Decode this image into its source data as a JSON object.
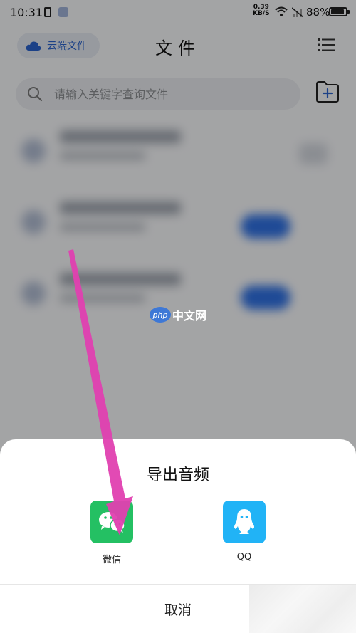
{
  "status_bar": {
    "time": "10:31",
    "net_speed_value": "0.39",
    "net_speed_unit": "KB/S",
    "battery": "88%"
  },
  "header": {
    "cloud_button_label": "云端文件",
    "title": "文件",
    "menu_icon": "list-icon"
  },
  "search": {
    "placeholder": "请输入关键字查询文件",
    "icon": "search-icon"
  },
  "new_folder_icon": "folder-plus-icon",
  "watermark": {
    "badge": "php",
    "text": "中文网"
  },
  "export_sheet": {
    "title": "导出音频",
    "options": [
      {
        "label": "微信",
        "icon": "wechat-icon",
        "color": "#24c063"
      },
      {
        "label": "QQ",
        "icon": "qq-icon",
        "color": "#21b3f6"
      }
    ],
    "cancel_label": "取消"
  },
  "colors": {
    "accent_blue": "#2a62c9",
    "arrow": "#e040b0"
  }
}
